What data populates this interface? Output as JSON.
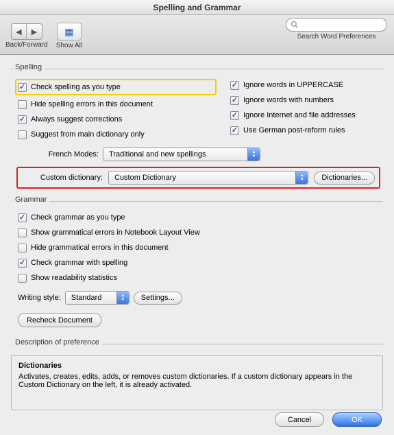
{
  "window": {
    "title": "Spelling and Grammar"
  },
  "toolbar": {
    "back_forward_label": "Back/Forward",
    "show_all_label": "Show All",
    "search_placeholder": "",
    "search_label": "Search Word Preferences"
  },
  "spelling": {
    "legend": "Spelling",
    "check_as_type": "Check spelling as you type",
    "hide_errors": "Hide spelling errors in this document",
    "always_suggest": "Always suggest corrections",
    "suggest_main_only": "Suggest from main dictionary only",
    "ignore_uppercase": "Ignore words in UPPERCASE",
    "ignore_numbers": "Ignore words with numbers",
    "ignore_internet": "Ignore Internet and file addresses",
    "german_rules": "Use German post-reform rules",
    "french_modes_label": "French Modes:",
    "french_modes_value": "Traditional and new spellings",
    "custom_dict_label": "Custom dictionary:",
    "custom_dict_value": "Custom Dictionary",
    "dictionaries_button": "Dictionaries..."
  },
  "grammar": {
    "legend": "Grammar",
    "check_as_type": "Check grammar as you type",
    "show_notebook": "Show grammatical errors in Notebook Layout View",
    "hide_errors": "Hide grammatical errors in this document",
    "with_spelling": "Check grammar with spelling",
    "readability": "Show readability statistics",
    "writing_style_label": "Writing style:",
    "writing_style_value": "Standard",
    "settings_button": "Settings...",
    "recheck_button": "Recheck Document"
  },
  "description": {
    "legend": "Description of preference",
    "title": "Dictionaries",
    "body": "Activates, creates, edits, adds, or removes custom dictionaries. If a custom dictionary appears in the Custom Dictionary on the left, it is already activated."
  },
  "footer": {
    "cancel": "Cancel",
    "ok": "OK"
  }
}
